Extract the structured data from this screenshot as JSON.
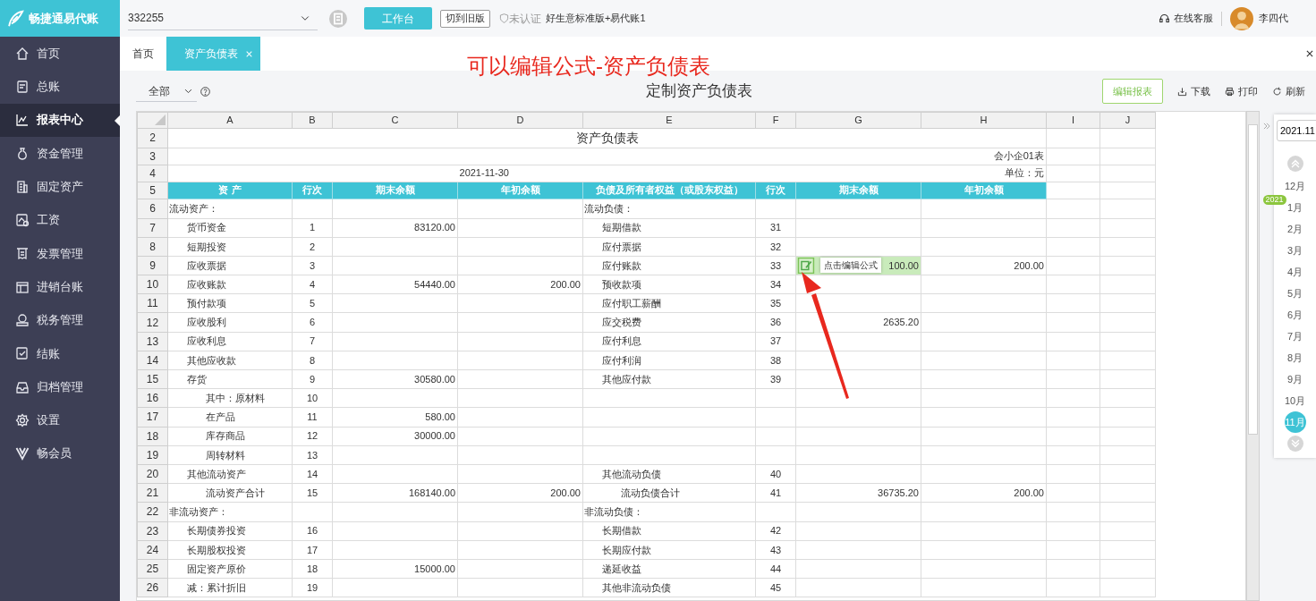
{
  "app": {
    "logo": "畅捷通易代账",
    "account": "332255",
    "workbench_button": "工作台",
    "old_version_button": "切到旧版",
    "certification": "未认证",
    "edition": "好生意标准版+易代账1",
    "support": "在线客服",
    "user": "李四代"
  },
  "sidebar": {
    "items": [
      {
        "label": "首页",
        "selected": false
      },
      {
        "label": "总账",
        "selected": false
      },
      {
        "label": "报表中心",
        "selected": true
      },
      {
        "label": "资金管理",
        "selected": false
      },
      {
        "label": "固定资产",
        "selected": false
      },
      {
        "label": "工资",
        "selected": false
      },
      {
        "label": "发票管理",
        "selected": false
      },
      {
        "label": "进销台账",
        "selected": false
      },
      {
        "label": "税务管理",
        "selected": false
      },
      {
        "label": "结账",
        "selected": false
      },
      {
        "label": "归档管理",
        "selected": false
      },
      {
        "label": "设置",
        "selected": false
      },
      {
        "label": "畅会员",
        "selected": false
      }
    ]
  },
  "tabs": [
    {
      "label": "首页",
      "selected": false,
      "closable": false
    },
    {
      "label": "资产负债表",
      "selected": true,
      "closable": true
    }
  ],
  "annotation": {
    "text": "可以编辑公式-资产负债表"
  },
  "toolbar": {
    "filter": "全部",
    "title": "定制资产负债表",
    "edit_button": "编辑报表",
    "download": "下载",
    "print": "打印",
    "refresh": "刷新"
  },
  "sheet": {
    "columns": [
      "A",
      "B",
      "C",
      "D",
      "E",
      "F",
      "G",
      "H",
      "I",
      "J"
    ],
    "title_rows": [
      {
        "number": "2",
        "text": "资产负债表"
      },
      {
        "number": "3",
        "form_code": "会小企01表"
      },
      {
        "number": "4",
        "date": "2021-11-30",
        "unit": "单位：元"
      }
    ],
    "header_row": {
      "number": "5",
      "cells": [
        "资 产",
        "行次",
        "期末余额",
        "年初余额",
        "负债及所有者权益（或股东权益）",
        "行次",
        "期末余额",
        "年初余额"
      ]
    },
    "rows": [
      {
        "number": "6",
        "selected": false,
        "A": {
          "text": "流动资产：",
          "kind": "heading"
        },
        "E": {
          "text": "流动负债：",
          "kind": "heading"
        }
      },
      {
        "number": "7",
        "selected": false,
        "A": {
          "text": "货币资金",
          "kind": "item"
        },
        "B": "1",
        "C": "83120.00",
        "E": {
          "text": "短期借款",
          "kind": "item"
        },
        "F": "31"
      },
      {
        "number": "8",
        "selected": false,
        "A": {
          "text": "短期投资",
          "kind": "item"
        },
        "B": "2",
        "E": {
          "text": "应付票据",
          "kind": "item"
        },
        "F": "32"
      },
      {
        "number": "9",
        "selected": true,
        "tooltip": "点击编辑公式",
        "A": {
          "text": "应收票据",
          "kind": "item"
        },
        "B": "3",
        "E": {
          "text": "应付账款",
          "kind": "item"
        },
        "F": "33",
        "G": "100.00",
        "H": "200.00"
      },
      {
        "number": "10",
        "selected": false,
        "A": {
          "text": "应收账款",
          "kind": "item"
        },
        "B": "4",
        "C": "54440.00",
        "D": "200.00",
        "E": {
          "text": "预收款项",
          "kind": "item"
        },
        "F": "34"
      },
      {
        "number": "11",
        "selected": false,
        "A": {
          "text": "预付款项",
          "kind": "item"
        },
        "B": "5",
        "E": {
          "text": "应付职工薪酬",
          "kind": "item"
        },
        "F": "35"
      },
      {
        "number": "12",
        "selected": false,
        "A": {
          "text": "应收股利",
          "kind": "item"
        },
        "B": "6",
        "E": {
          "text": "应交税费",
          "kind": "item"
        },
        "F": "36",
        "G": "2635.20"
      },
      {
        "number": "13",
        "selected": false,
        "A": {
          "text": "应收利息",
          "kind": "item"
        },
        "B": "7",
        "E": {
          "text": "应付利息",
          "kind": "item"
        },
        "F": "37"
      },
      {
        "number": "14",
        "selected": false,
        "A": {
          "text": "其他应收款",
          "kind": "item"
        },
        "B": "8",
        "E": {
          "text": "应付利润",
          "kind": "item"
        },
        "F": "38"
      },
      {
        "number": "15",
        "selected": false,
        "A": {
          "text": "存货",
          "kind": "item"
        },
        "B": "9",
        "C": "30580.00",
        "E": {
          "text": "其他应付款",
          "kind": "item"
        },
        "F": "39"
      },
      {
        "number": "16",
        "selected": false,
        "A": {
          "text": "其中：原材料",
          "kind": "sub"
        },
        "B": "10"
      },
      {
        "number": "17",
        "selected": false,
        "A": {
          "text": "在产品",
          "kind": "sub"
        },
        "B": "11",
        "C": "580.00"
      },
      {
        "number": "18",
        "selected": false,
        "A": {
          "text": "库存商品",
          "kind": "sub"
        },
        "B": "12",
        "C": "30000.00"
      },
      {
        "number": "19",
        "selected": false,
        "A": {
          "text": "周转材料",
          "kind": "sub"
        },
        "B": "13"
      },
      {
        "number": "20",
        "selected": false,
        "A": {
          "text": "其他流动资产",
          "kind": "item"
        },
        "B": "14",
        "E": {
          "text": "其他流动负债",
          "kind": "item"
        },
        "F": "40"
      },
      {
        "number": "21",
        "selected": false,
        "A": {
          "text": "流动资产合计",
          "kind": "sub"
        },
        "B": "15",
        "C": "168140.00",
        "D": "200.00",
        "E": {
          "text": "流动负债合计",
          "kind": "sub"
        },
        "F": "41",
        "G": "36735.20",
        "H": "200.00"
      },
      {
        "number": "22",
        "selected": false,
        "A": {
          "text": "非流动资产：",
          "kind": "heading"
        },
        "E": {
          "text": "非流动负债：",
          "kind": "heading"
        }
      },
      {
        "number": "23",
        "selected": false,
        "A": {
          "text": "长期债券投资",
          "kind": "item"
        },
        "B": "16",
        "E": {
          "text": "长期借款",
          "kind": "item"
        },
        "F": "42"
      },
      {
        "number": "24",
        "selected": false,
        "A": {
          "text": "长期股权投资",
          "kind": "item"
        },
        "B": "17",
        "E": {
          "text": "长期应付款",
          "kind": "item"
        },
        "F": "43"
      },
      {
        "number": "25",
        "selected": false,
        "A": {
          "text": "固定资产原价",
          "kind": "item"
        },
        "B": "18",
        "C": "15000.00",
        "E": {
          "text": "递延收益",
          "kind": "item"
        },
        "F": "44"
      },
      {
        "number": "26",
        "selected": false,
        "A": {
          "text": "减：累计折旧",
          "kind": "item"
        },
        "B": "19",
        "E": {
          "text": "其他非流动负债",
          "kind": "item"
        },
        "F": "45"
      }
    ]
  },
  "period_picker": {
    "value": "2021.11",
    "months": [
      {
        "label": "12月",
        "selected": false
      },
      {
        "label": "1月",
        "selected": false,
        "year": "2021"
      },
      {
        "label": "2月",
        "selected": false
      },
      {
        "label": "3月",
        "selected": false
      },
      {
        "label": "4月",
        "selected": false
      },
      {
        "label": "5月",
        "selected": false
      },
      {
        "label": "6月",
        "selected": false
      },
      {
        "label": "7月",
        "selected": false
      },
      {
        "label": "8月",
        "selected": false
      },
      {
        "label": "9月",
        "selected": false
      },
      {
        "label": "10月",
        "selected": false
      },
      {
        "label": "11月",
        "selected": true
      }
    ]
  }
}
